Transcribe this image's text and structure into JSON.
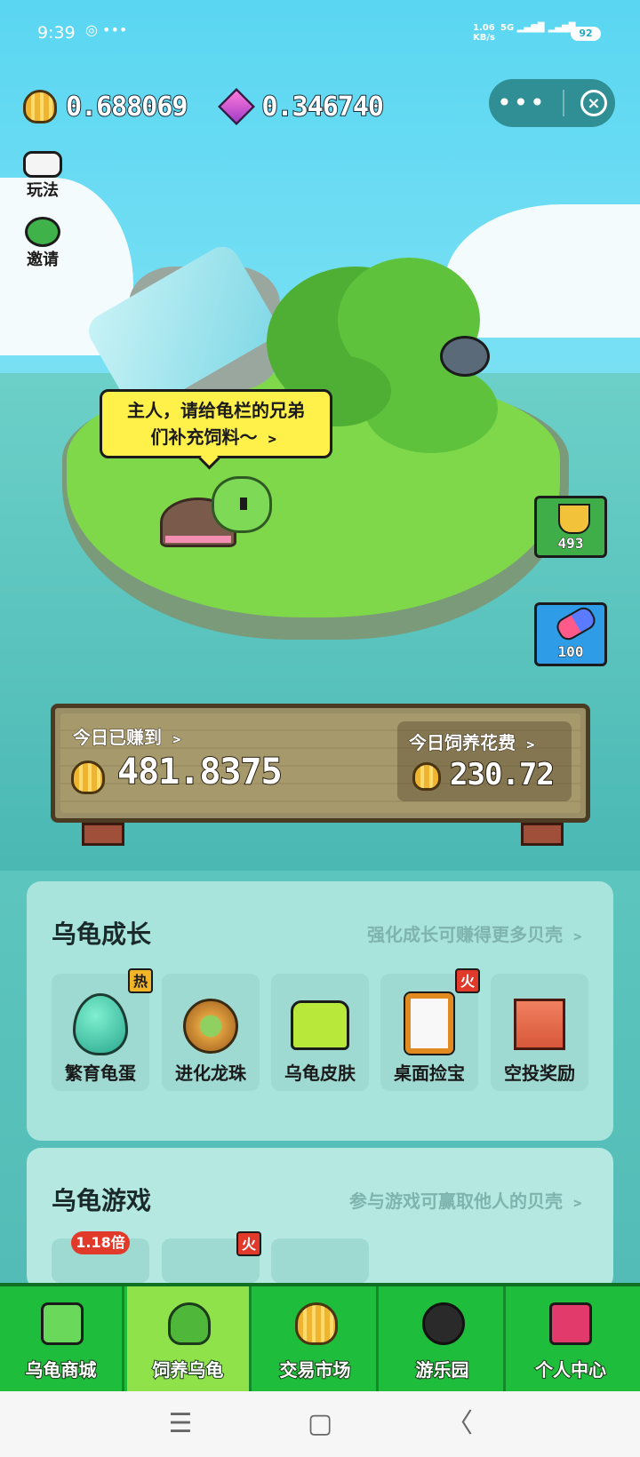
{
  "status_bar": {
    "time": "9:39",
    "speed": "1.06\nKB/s",
    "net1": "5G",
    "net2": "5G",
    "battery": "92"
  },
  "header": {
    "shell_balance": "0.688069",
    "gem_balance": "0.346740"
  },
  "side": {
    "play_label": "玩法",
    "invite_label": "邀请"
  },
  "bubble": {
    "text_line1": "主人，请给龟栏的兄弟",
    "text_line2": "们补充饲料～ ﹥"
  },
  "right_buttons": {
    "food_count": "493",
    "medicine_count": "100"
  },
  "board": {
    "earned_label": "今日已赚到 ﹥",
    "earned_value": "481.8375",
    "cost_label": "今日饲养花费 ﹥",
    "cost_value": "230.72"
  },
  "growth": {
    "title": "乌龟成长",
    "link": "强化成长可赚得更多贝壳 ﹥",
    "cards": [
      {
        "label": "繁育龟蛋",
        "badge": "热"
      },
      {
        "label": "进化龙珠",
        "badge": ""
      },
      {
        "label": "乌龟皮肤",
        "badge": ""
      },
      {
        "label": "桌面捡宝",
        "badge": "火"
      },
      {
        "label": "空投奖励",
        "badge": ""
      }
    ]
  },
  "games": {
    "title": "乌龟游戏",
    "link": "参与游戏可赢取他人的贝壳 ﹥",
    "multiplier_badge": "1.18倍",
    "fire_badge": "火"
  },
  "tabs": [
    {
      "label": "乌龟商城",
      "icon": "turtle-face-icon"
    },
    {
      "label": "饲养乌龟",
      "icon": "green-slime-icon"
    },
    {
      "label": "交易市场",
      "icon": "shell-icon"
    },
    {
      "label": "游乐园",
      "icon": "bomb-icon"
    },
    {
      "label": "个人中心",
      "icon": "treasure-chest-icon"
    }
  ],
  "nav": {
    "menu": "☰",
    "home": "▢",
    "back": "〈"
  }
}
